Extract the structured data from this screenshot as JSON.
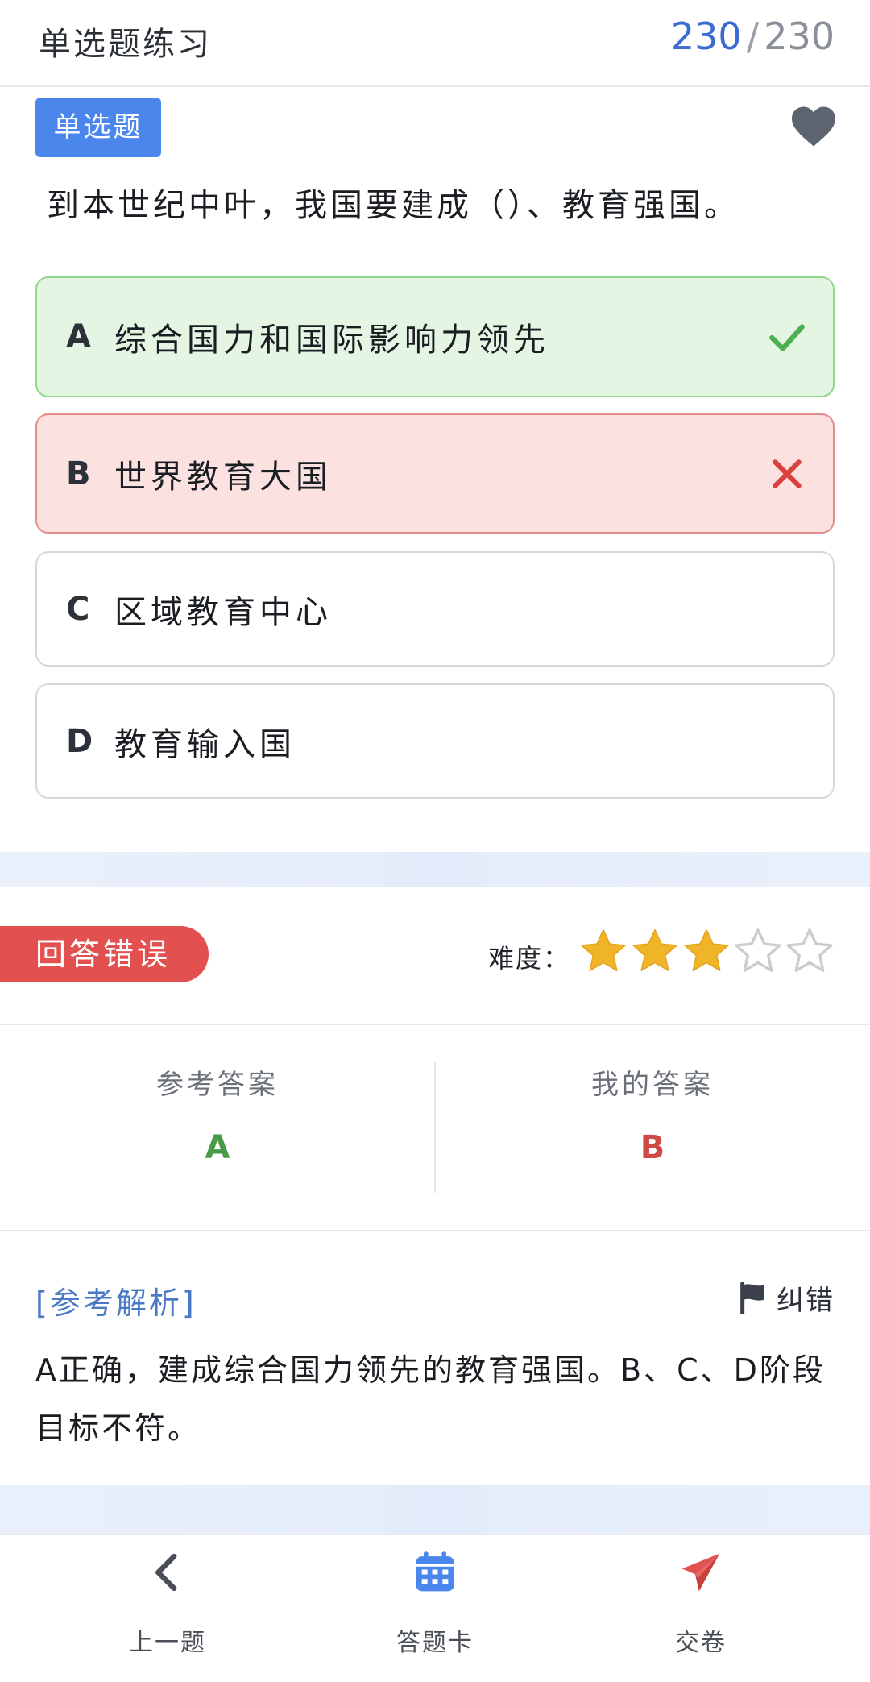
{
  "header": {
    "title": "单选题练习",
    "current": "230",
    "separator": "/",
    "total": "230"
  },
  "question": {
    "type_tag": "单选题",
    "text": "到本世纪中叶，我国要建成（）、教育强国。",
    "favorite_icon": "heart-icon",
    "options": [
      {
        "letter": "A",
        "text": "综合国力和国际影响力领先",
        "state": "correct",
        "icon": "check-icon",
        "color": "#4caf50"
      },
      {
        "letter": "B",
        "text": "世界教育大国",
        "state": "wrong",
        "icon": "close-icon",
        "color": "#d9413e"
      },
      {
        "letter": "C",
        "text": "区域教育中心",
        "state": "normal"
      },
      {
        "letter": "D",
        "text": "教育输入国",
        "state": "normal"
      }
    ]
  },
  "result": {
    "status": "回答错误",
    "difficulty_label": "难度：",
    "difficulty_rating": 3,
    "difficulty_max": 5,
    "reference_label": "参考答案",
    "reference_value": "A",
    "mine_label": "我的答案",
    "mine_value": "B"
  },
  "analysis": {
    "title": "[参考解析]",
    "report_label": "纠错",
    "report_icon": "flag-icon",
    "text": "A正确，建成综合国力领先的教育强国。B、C、D阶段目标不符。"
  },
  "bottom_nav": {
    "prev_label": "上一题",
    "prev_icon": "chevron-left-icon",
    "card_label": "答题卡",
    "card_icon": "calendar-icon",
    "submit_label": "交卷",
    "submit_icon": "send-icon"
  },
  "colors": {
    "accent": "#3b6bd1",
    "correct": "#4caf50",
    "wrong": "#e2514f",
    "star": "#f0b429"
  }
}
